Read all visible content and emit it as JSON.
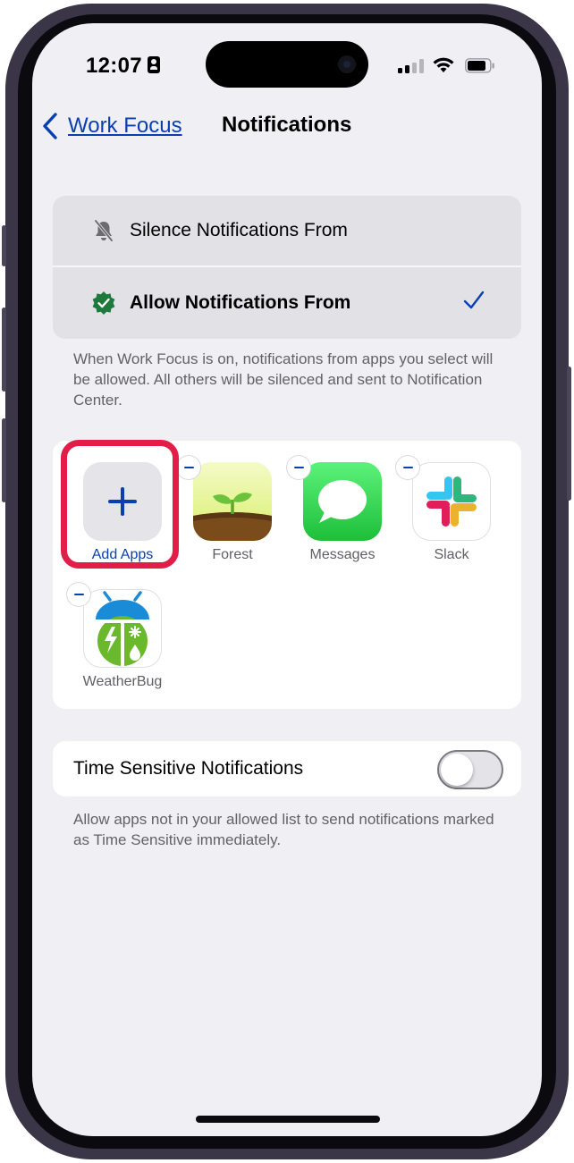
{
  "status_bar": {
    "time": "12:07"
  },
  "nav": {
    "back_label": "Work Focus",
    "title": "Notifications"
  },
  "options": {
    "silence_label": "Silence Notifications From",
    "allow_label": "Allow Notifications From",
    "selected": "allow"
  },
  "allow_note": "When Work Focus is on, notifications from apps you select will be allowed. All others will be silenced and sent to Notification Center.",
  "apps": {
    "add_label": "Add Apps",
    "items": [
      {
        "name": "Forest",
        "icon": "forest-icon"
      },
      {
        "name": "Messages",
        "icon": "messages-icon"
      },
      {
        "name": "Slack",
        "icon": "slack-icon"
      },
      {
        "name": "WeatherBug",
        "icon": "weatherbug-icon"
      }
    ]
  },
  "time_sensitive": {
    "label": "Time Sensitive Notifications",
    "enabled": false,
    "note": "Allow apps not in your allowed list to send notifications marked as Time Sensitive immediately."
  },
  "colors": {
    "accent": "#0a3fb0",
    "highlight": "#e11d48",
    "toggle_off": "#e3e3e8"
  }
}
